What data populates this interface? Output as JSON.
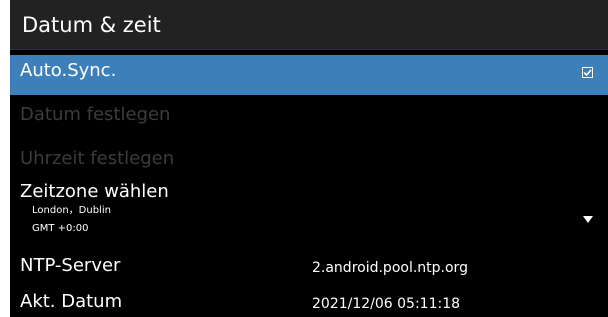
{
  "header": {
    "title": "Datum & zeit"
  },
  "settings": {
    "auto_sync": {
      "label": "Auto.Sync.",
      "checked": true,
      "checkbox_icon": "checkbox-checked-icon"
    },
    "set_date": {
      "label": "Datum festlegen",
      "enabled": false
    },
    "set_time": {
      "label": "Uhrzeit festlegen",
      "enabled": false
    },
    "timezone": {
      "label": "Zeitzone wählen",
      "city": "London，Dublin",
      "offset": "GMT +0:00",
      "dropdown_icon": "triangle-down-icon"
    },
    "ntp_server": {
      "label": "NTP-Server",
      "value": "2.android.pool.ntp.org"
    },
    "current_date": {
      "label": "Akt. Datum",
      "value": "2021/12/06 05:11:18"
    }
  },
  "colors": {
    "background": "#000000",
    "header_background": "#222222",
    "selection": "#3d7fb9",
    "text": "#ffffff",
    "disabled_text": "#3c3c3c"
  }
}
